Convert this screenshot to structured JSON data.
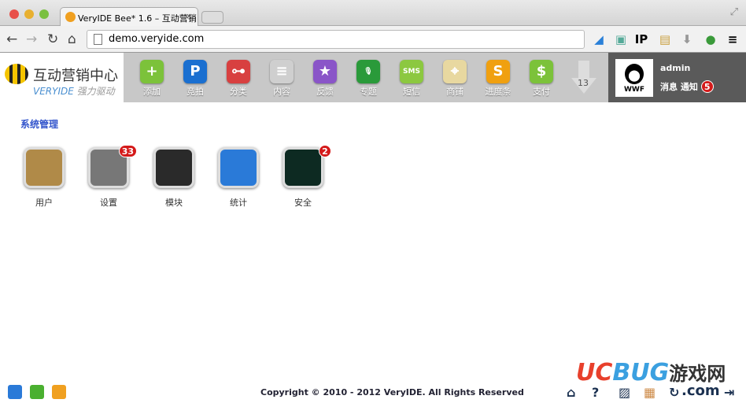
{
  "browser": {
    "tab_title": "VeryIDE Bee* 1.6 – 互动营销",
    "url": "demo.veryide.com",
    "ext_ip": "IP"
  },
  "logo": {
    "title": "互动营销中心",
    "brand": "VERYIDE",
    "slogan": "强力驱动"
  },
  "toolbar": [
    {
      "label": "添加",
      "glyph": "+",
      "color": "#7cc23a"
    },
    {
      "label": "竞拍",
      "glyph": "P",
      "color": "#1a6fd0"
    },
    {
      "label": "分类",
      "glyph": "⊶",
      "color": "#d84040"
    },
    {
      "label": "内容",
      "glyph": "≡",
      "color": "#cfcfcf"
    },
    {
      "label": "反馈",
      "glyph": "★",
      "color": "#8a55c8"
    },
    {
      "label": "专题",
      "glyph": "🎙",
      "color": "#2a9a3a"
    },
    {
      "label": "短信",
      "glyph": "SMS",
      "color": "#8cc840"
    },
    {
      "label": "商铺",
      "glyph": "⌖",
      "color": "#e8d8a0"
    },
    {
      "label": "进度条",
      "glyph": "S",
      "color": "#f0a010"
    },
    {
      "label": "支付",
      "glyph": "$",
      "color": "#7cc23a"
    }
  ],
  "more_count": "13",
  "user": {
    "name": "admin",
    "messages": "消息",
    "notices": "通知",
    "notice_count": "5",
    "avatar_text": "WWF"
  },
  "section_title": "系统管理",
  "apps": [
    {
      "label": "用户",
      "badge": null,
      "color": "#b08a48"
    },
    {
      "label": "设置",
      "badge": "33",
      "color": "#777777"
    },
    {
      "label": "模块",
      "badge": null,
      "color": "#2a2a2a"
    },
    {
      "label": "统计",
      "badge": null,
      "color": "#2a7ad8"
    },
    {
      "label": "安全",
      "badge": "2",
      "color": "#0d2a22"
    }
  ],
  "footer": {
    "copyright": "Copyright © 2010 - 2012 VeryIDE. All Rights Reserved"
  },
  "watermark": {
    "uc": "UC",
    "bug": "BUG",
    "cn": "游戏网",
    "com": ".com"
  }
}
